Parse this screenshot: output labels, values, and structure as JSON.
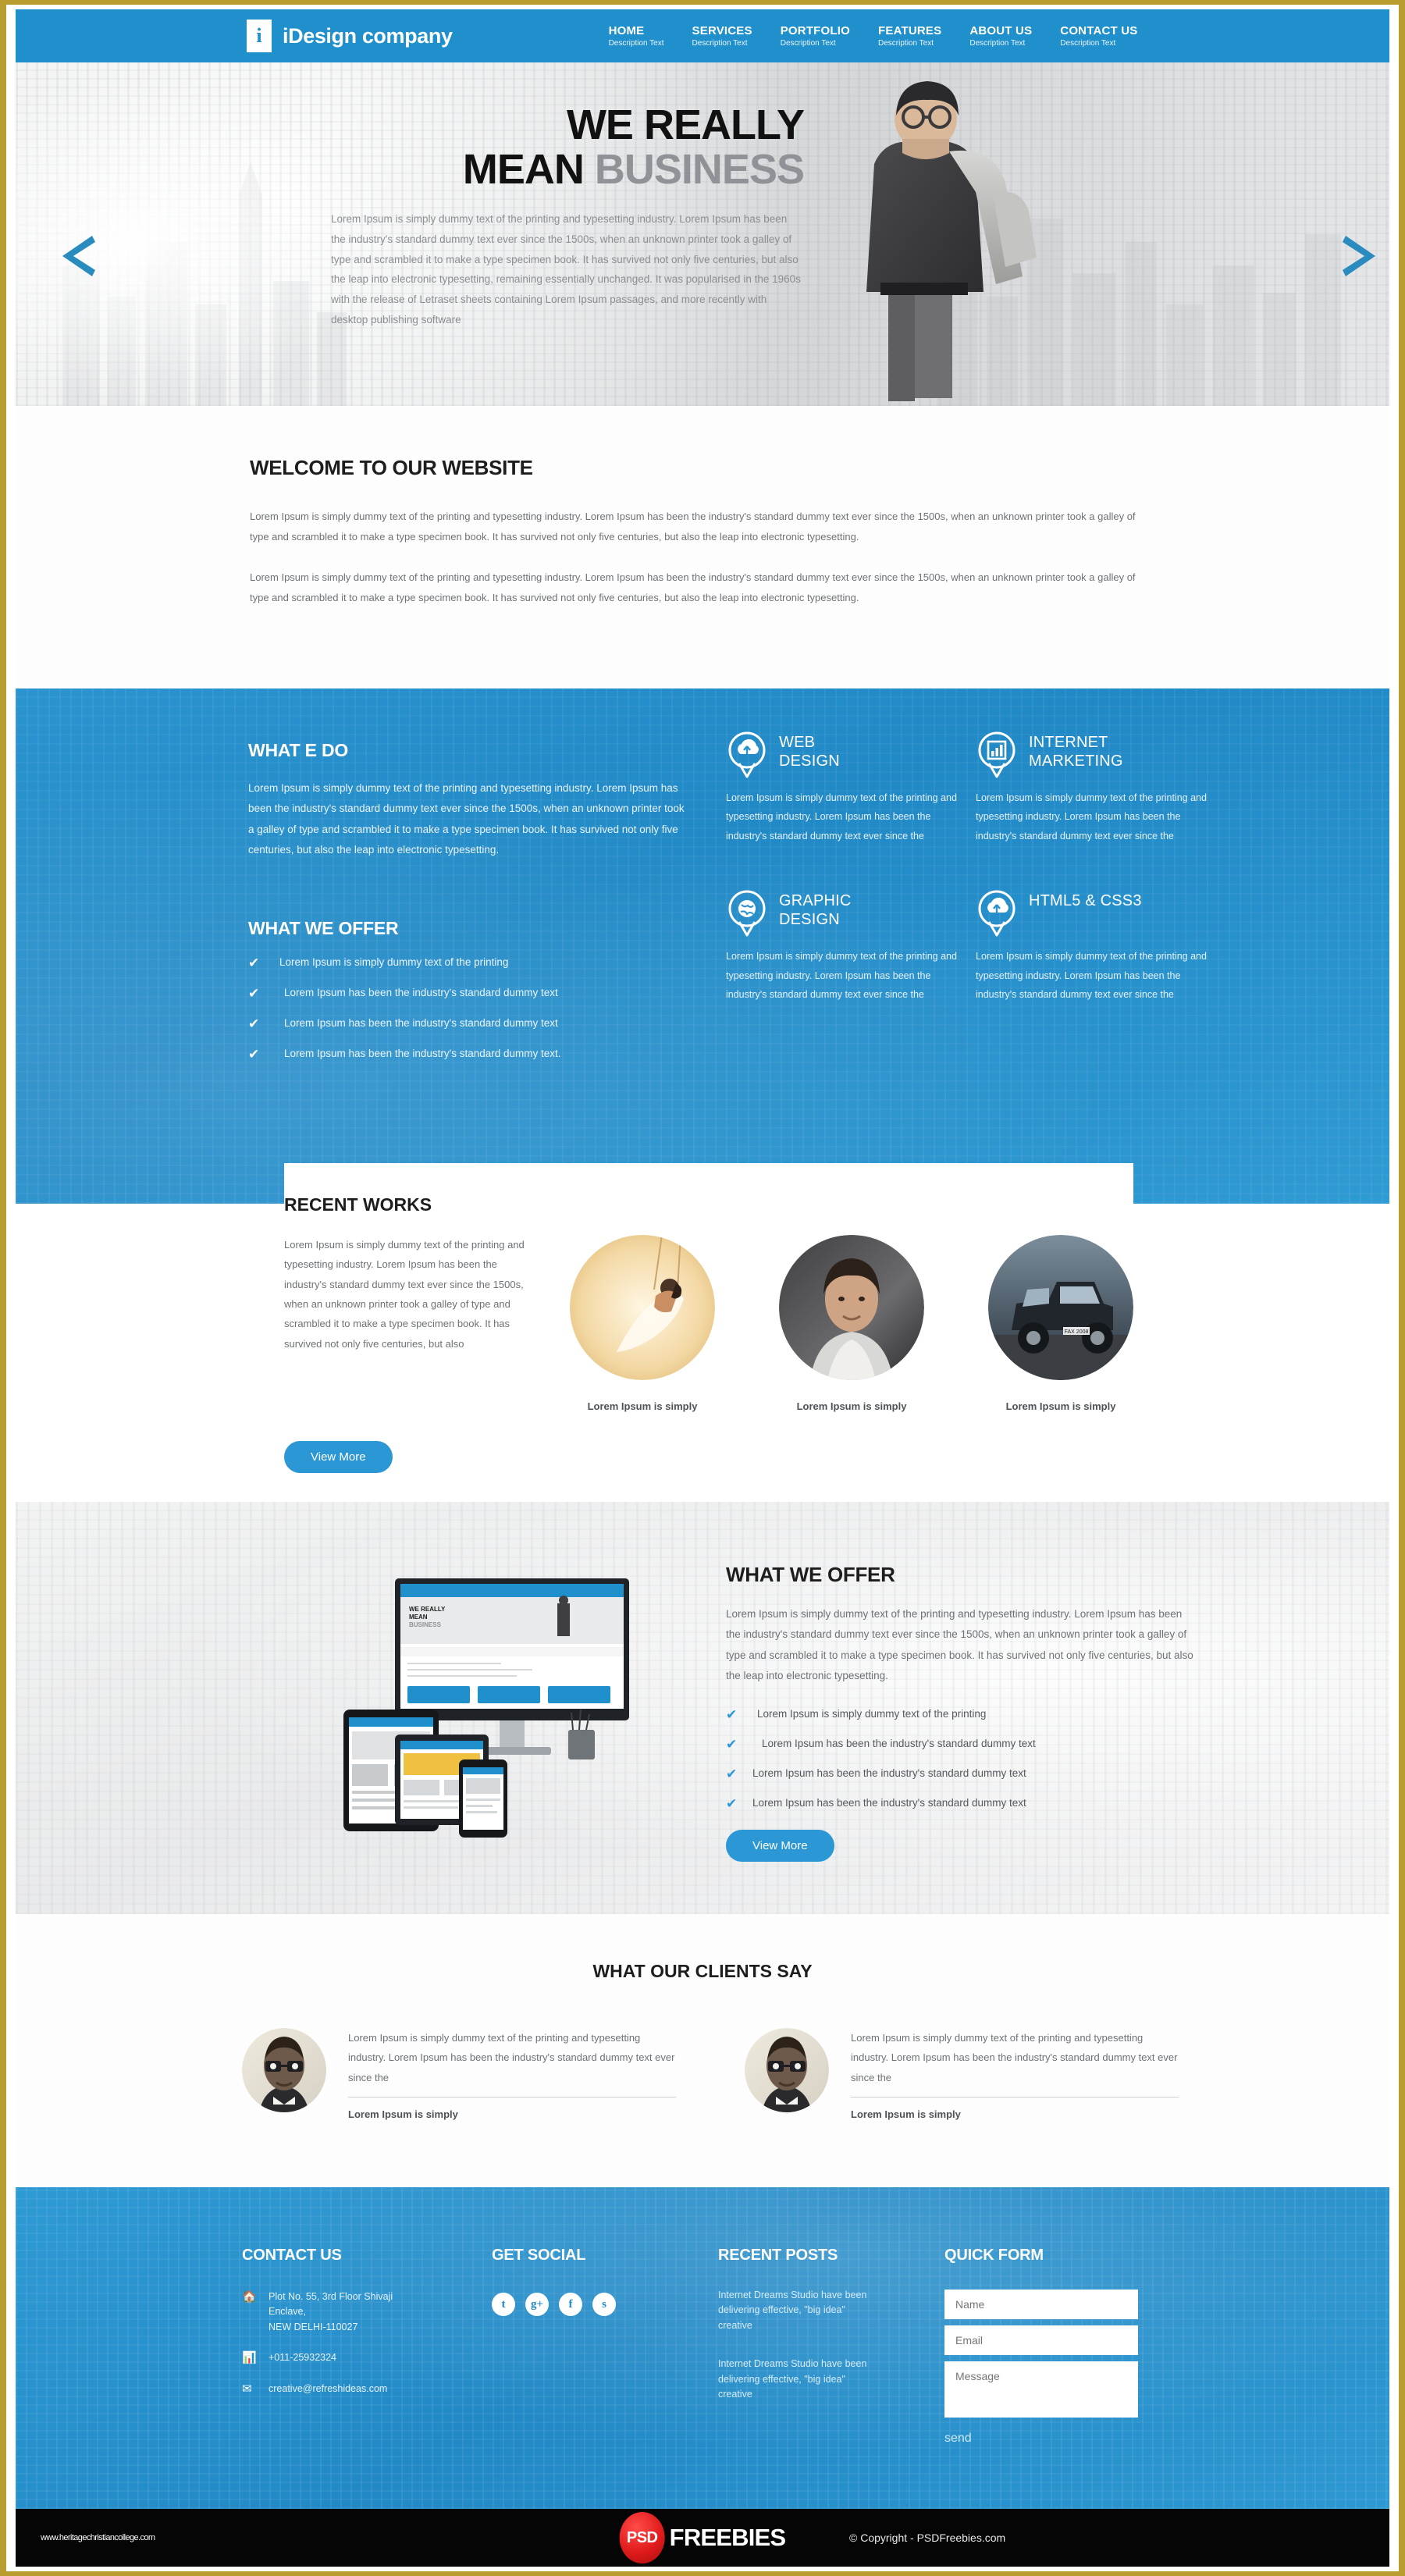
{
  "theme": {
    "accent": "#2090cd",
    "accent_button": "#2b97d4",
    "frame": "#c9a227",
    "dark_text": "#1d1d1d",
    "body_text": "#6d7276",
    "black_bar": "#050505",
    "psd_red": "#e01b1b"
  },
  "header": {
    "logo_mark": "i",
    "brand": "iDesign company",
    "nav": [
      {
        "title": "HOME",
        "sub": "Description Text"
      },
      {
        "title": "SERVICES",
        "sub": "Description Text"
      },
      {
        "title": "PORTFOLIO",
        "sub": "Description Text"
      },
      {
        "title": "FEATURES",
        "sub": "Description Text"
      },
      {
        "title": "ABOUT US",
        "sub": "Description Text"
      },
      {
        "title": "CONTACT US",
        "sub": "Description Text"
      }
    ]
  },
  "hero": {
    "headline_line1": "WE REALLY",
    "headline_line2_strong": "MEAN",
    "headline_line2_muted": "BUSINESS",
    "body": "Lorem Ipsum is simply dummy text of the printing and typesetting industry. Lorem Ipsum has been the industry's standard dummy text ever since the 1500s, when an unknown printer took a galley of type and scrambled it to make a type specimen book. It has survived not only five centuries, but also the leap into electronic typesetting, remaining essentially unchanged. It was popularised in the 1960s with the release of Letraset sheets containing Lorem Ipsum passages, and more recently with desktop publishing software",
    "prev_icon": "chevron-left-icon",
    "next_icon": "chevron-right-icon"
  },
  "welcome": {
    "title": "WELCOME TO OUR WEBSITE",
    "paragraph1": "Lorem Ipsum is simply dummy text of the printing and typesetting industry. Lorem Ipsum has been the industry's standard dummy text ever since the 1500s, when an unknown printer took a galley of type and scrambled it to make a type specimen book. It has survived not only five centuries, but also the leap into electronic typesetting.",
    "paragraph2": "Lorem Ipsum is simply dummy text of the printing and typesetting industry. Lorem Ipsum has been the industry's standard dummy text ever since the 1500s, when an unknown printer took a galley of type and scrambled it to make a type specimen book. It has survived not only five centuries, but also the leap into electronic typesetting."
  },
  "services": {
    "what_we_do_title": "WHAT E DO",
    "what_we_do_body": "Lorem Ipsum is simply dummy text of the printing and typesetting industry. Lorem Ipsum has been the industry's standard dummy text ever since the 1500s, when an unknown printer took a galley of type and scrambled it to make a type specimen book. It has survived not only five centuries, but also the leap into electronic typesetting.",
    "what_we_offer_title": "WHAT WE OFFER",
    "offer_items": [
      "Lorem Ipsum is simply dummy text of the printing",
      "Lorem Ipsum has been the industry's standard dummy text",
      "Lorem Ipsum has been the industry's standard dummy text",
      "Lorem Ipsum has been the industry's standard dummy text."
    ],
    "cards": [
      {
        "icon": "cloud-upload-pin-icon",
        "title_line1": "WEB",
        "title_line2": "DESIGN",
        "body": "Lorem Ipsum is simply dummy text of the printing and typesetting industry. Lorem Ipsum has been the industry's standard dummy text ever since the"
      },
      {
        "icon": "bar-chart-pin-icon",
        "title_line1": "INTERNET",
        "title_line2": "MARKETING",
        "body": "Lorem Ipsum is simply dummy text of the printing and typesetting industry. Lorem Ipsum has been the industry's standard dummy text ever since the"
      },
      {
        "icon": "globe-pin-icon",
        "title_line1": "GRAPHIC",
        "title_line2": "DESIGN",
        "body": "Lorem Ipsum is simply dummy text of the printing and typesetting industry. Lorem Ipsum has been the industry's standard dummy text ever since the"
      },
      {
        "icon": "cloud-upload-pin-icon",
        "title_line1": "HTML5 & CSS3",
        "title_line2": "",
        "body": "Lorem Ipsum is simply dummy text of the printing and typesetting industry. Lorem Ipsum has been the industry's standard dummy text ever since the"
      }
    ]
  },
  "recent_works": {
    "title": "RECENT WORKS",
    "body": "Lorem Ipsum is simply dummy text of the printing and typesetting industry. Lorem Ipsum has been the industry's standard dummy text ever since the 1500s, when an unknown printer took a galley of type and scrambled it to make a type specimen book. It has survived not only five centuries, but also",
    "button": "View More",
    "thumbs": [
      {
        "caption": "Lorem Ipsum is simply",
        "alt": "bride-on-swing-photo"
      },
      {
        "caption": "Lorem Ipsum is simply",
        "alt": "male-model-portrait-photo"
      },
      {
        "caption": "Lorem Ipsum is simply",
        "alt": "off-road-vehicle-photo"
      }
    ]
  },
  "offer_section": {
    "title": "WHAT WE OFFER",
    "body": "Lorem Ipsum is simply dummy text of the printing and typesetting industry. Lorem Ipsum has been the industry's standard dummy text ever since the 1500s, when an unknown printer took a galley of type and scrambled it to make a type specimen book. It has survived not only five centuries, but also the leap into electronic typesetting.",
    "items": [
      "Lorem Ipsum is simply dummy text of the printing",
      "Lorem Ipsum has been the industry's standard dummy text",
      "Lorem Ipsum has been the industry's standard dummy text",
      "Lorem Ipsum has been the industry's standard dummy text"
    ],
    "button": "View More",
    "device_mock_headline1": "WE REALLY",
    "device_mock_headline2": "MEAN",
    "device_mock_headline3": "BUSINESS"
  },
  "clients": {
    "title": "WHAT OUR CLIENTS SAY",
    "items": [
      {
        "quote": "Lorem Ipsum is simply dummy text of the printing and typesetting industry. Lorem Ipsum has been the industry's standard dummy text ever since the",
        "name": "Lorem Ipsum is simply",
        "avatar": "client-portrait-photo"
      },
      {
        "quote": "Lorem Ipsum is simply dummy text of the printing and typesetting industry. Lorem Ipsum has been the industry's standard dummy text ever since the",
        "name": "Lorem Ipsum is simply",
        "avatar": "client-portrait-photo"
      }
    ]
  },
  "footer": {
    "contact": {
      "title": "CONTACT US",
      "address_line1": "Plot No. 55, 3rd Floor Shivaji",
      "address_line2": "Enclave,",
      "address_line3": "NEW DELHI-110027",
      "phone": "+011-25932324",
      "email": "creative@refreshideas.com"
    },
    "social": {
      "title": "GET SOCIAL",
      "icons": [
        {
          "name": "twitter-icon",
          "glyph": "t"
        },
        {
          "name": "google-plus-icon",
          "glyph": "g+"
        },
        {
          "name": "facebook-icon",
          "glyph": "f"
        },
        {
          "name": "skype-icon",
          "glyph": "s"
        }
      ]
    },
    "posts": {
      "title": "RECENT POSTS",
      "items": [
        "Internet Dreams Studio have been delivering effective, \"big idea\" creative",
        "Internet Dreams Studio have been delivering effective, \"big idea\" creative"
      ]
    },
    "form": {
      "title": "QUICK FORM",
      "name_placeholder": "Name",
      "email_placeholder": "Email",
      "message_placeholder": "Message",
      "send_label": "send"
    }
  },
  "bottom_bar": {
    "watermark": "www.heritagechristiancollege.com",
    "logo_badge": "PSD",
    "logo_word": "FREEBIES",
    "copyright": "© Copyright - PSDFreebies.com"
  }
}
